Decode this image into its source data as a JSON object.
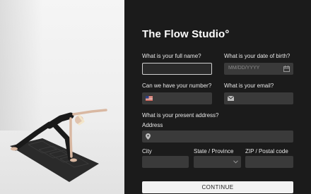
{
  "brand": {
    "title": "The Flow Studio°"
  },
  "form": {
    "full_name": {
      "label": "What is your full name?",
      "value": ""
    },
    "dob": {
      "label": "What is your date of birth?",
      "placeholder": "MM/DD/YYYY",
      "icon": "calendar-icon"
    },
    "phone": {
      "label": "Can we have your number?",
      "value": "",
      "icon": "us-flag-icon"
    },
    "email": {
      "label": "What is your email?",
      "value": "",
      "icon": "envelope-icon"
    },
    "address_section": {
      "label": "What is your present address?"
    },
    "address": {
      "label": "Address",
      "value": "",
      "icon": "location-pin-icon"
    },
    "city": {
      "label": "City",
      "value": ""
    },
    "state": {
      "label": "State / Province",
      "value": "",
      "icon": "chevron-down-icon"
    },
    "zip": {
      "label": "ZIP / Postal code",
      "value": ""
    },
    "submit_label": "CONTINUE"
  }
}
